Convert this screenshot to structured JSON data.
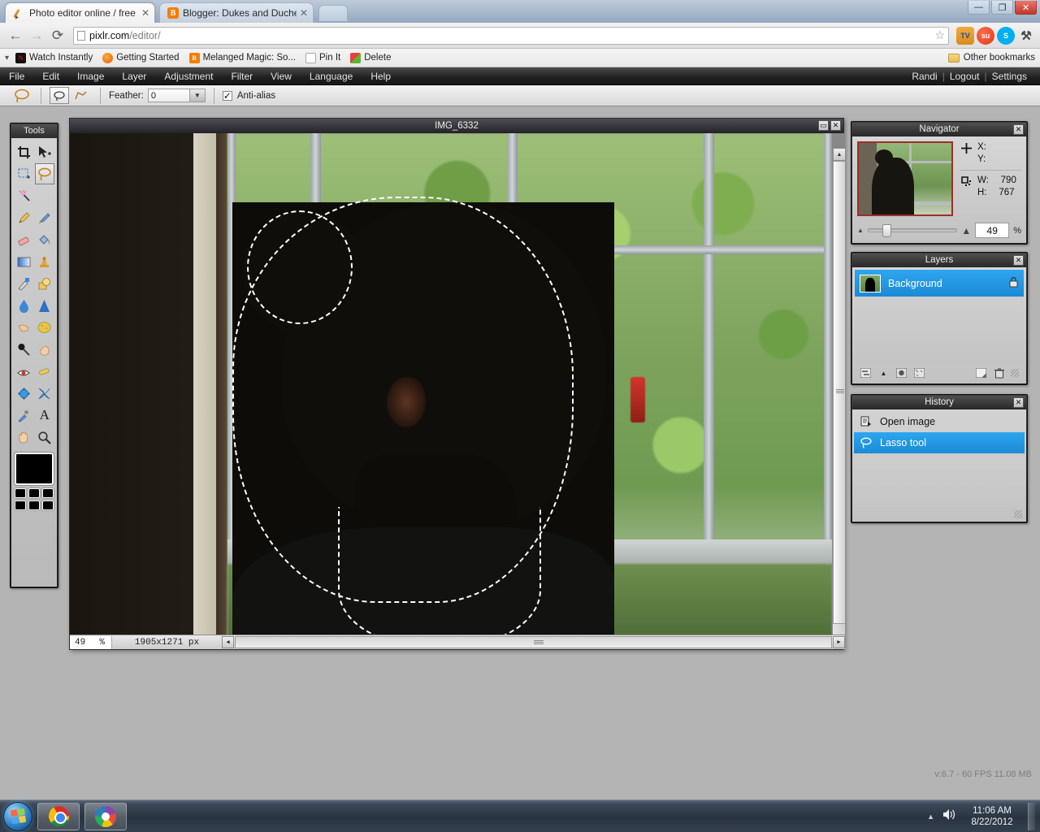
{
  "browser": {
    "tabs": [
      {
        "title": "Photo editor online / free i",
        "favicon": "pencil-icon",
        "active": true
      },
      {
        "title": "Blogger: Dukes and Duche",
        "favicon": "blogger-icon",
        "active": false
      }
    ],
    "new_tab_label": "",
    "window_buttons": {
      "minimize": "—",
      "maximize": "❐",
      "close": "✕"
    },
    "nav": {
      "back": "←",
      "forward": "→",
      "reload": "⟳"
    },
    "url": {
      "host": "pixlr.com",
      "path": "/editor/"
    },
    "star_icon": "☆",
    "extensions": [
      {
        "name": "tv-extension-icon",
        "label": "TV"
      },
      {
        "name": "stumbleupon-icon",
        "label": "su"
      },
      {
        "name": "skype-icon",
        "label": "S"
      },
      {
        "name": "wrench-menu-icon",
        "label": "⚒"
      }
    ],
    "bookmarks": [
      {
        "label": "Watch Instantly",
        "icon": "netflix-icon"
      },
      {
        "label": "Getting Started",
        "icon": "firefox-icon"
      },
      {
        "label": "Melanged Magic: So...",
        "icon": "blogger-icon"
      },
      {
        "label": "Pin It",
        "icon": "page-icon"
      },
      {
        "label": "Delete",
        "icon": "windows-icon"
      }
    ],
    "other_bookmarks": "Other bookmarks"
  },
  "pixlr": {
    "menus": [
      "File",
      "Edit",
      "Image",
      "Layer",
      "Adjustment",
      "Filter",
      "View",
      "Language",
      "Help"
    ],
    "account": {
      "user": "Randi",
      "logout": "Logout",
      "settings": "Settings",
      "separator": "|"
    },
    "options_bar": {
      "active_tool_icon": "lasso-icon",
      "mode_buttons": [
        {
          "name": "lasso-freehand-mode",
          "icon": "lasso-icon",
          "selected": true
        },
        {
          "name": "lasso-polygon-mode",
          "icon": "polygon-lasso-icon",
          "selected": false
        }
      ],
      "feather_label": "Feather:",
      "feather_value": "0",
      "antialias_label": "Anti-alias",
      "antialias_checked": true,
      "check_glyph": "✓",
      "dropdown_glyph": "▼"
    },
    "tools": {
      "title": "Tools",
      "items": [
        {
          "name": "crop-tool",
          "glyph": "⛶",
          "selected": false
        },
        {
          "name": "move-tool",
          "glyph": "➤",
          "selected": false
        },
        {
          "name": "marquee-select-tool",
          "glyph": "⬚",
          "selected": false
        },
        {
          "name": "lasso-tool",
          "glyph": "◯",
          "selected": true
        },
        {
          "name": "wand-select-tool",
          "glyph": "✦",
          "selected": false
        },
        {
          "name": "spacer-tool",
          "glyph": "",
          "selected": false
        },
        {
          "name": "pencil-tool",
          "glyph": "✎",
          "selected": false
        },
        {
          "name": "brush-tool",
          "glyph": "🖌",
          "selected": false
        },
        {
          "name": "eraser-tool",
          "glyph": "▰",
          "selected": false
        },
        {
          "name": "paint-bucket-tool",
          "glyph": "⛃",
          "selected": false
        },
        {
          "name": "gradient-tool",
          "glyph": "■",
          "selected": false
        },
        {
          "name": "clone-stamp-tool",
          "glyph": "♟",
          "selected": false
        },
        {
          "name": "replace-color-tool",
          "glyph": "✒",
          "selected": false
        },
        {
          "name": "drawing-shape-tool",
          "glyph": "▭",
          "selected": false
        },
        {
          "name": "blur-tool",
          "glyph": "💧",
          "selected": false
        },
        {
          "name": "sharpen-tool",
          "glyph": "▲",
          "selected": false
        },
        {
          "name": "smudge-tool",
          "glyph": "☛",
          "selected": false
        },
        {
          "name": "sponge-tool",
          "glyph": "⬤",
          "selected": false
        },
        {
          "name": "dodge-tool",
          "glyph": "🍥",
          "selected": false
        },
        {
          "name": "burn-tool",
          "glyph": "✋",
          "selected": false
        },
        {
          "name": "red-eye-tool",
          "glyph": "◉",
          "selected": false
        },
        {
          "name": "doodle-tool",
          "glyph": "▬",
          "selected": false
        },
        {
          "name": "bloat-tool",
          "glyph": "⬤",
          "selected": false
        },
        {
          "name": "pinch-tool",
          "glyph": "✧",
          "selected": false
        },
        {
          "name": "color-picker-tool",
          "glyph": "✐",
          "selected": false
        },
        {
          "name": "type-tool",
          "glyph": "A",
          "selected": false
        },
        {
          "name": "hand-tool",
          "glyph": "✋",
          "selected": false
        },
        {
          "name": "zoom-tool",
          "glyph": "🔍",
          "selected": false
        }
      ],
      "primary_color": "#000000",
      "palette_colors": [
        "#000000",
        "#000000",
        "#000000",
        "#000000",
        "#000000",
        "#000000"
      ]
    },
    "canvas_window": {
      "title": "IMG_6332",
      "maximize_glyph": "▭",
      "close_glyph": "✕",
      "status": {
        "zoom": "49",
        "percent": "%",
        "dimensions": "1905x1271 px"
      }
    },
    "navigator": {
      "title": "Navigator",
      "close_glyph": "✕",
      "crosshair_icon": "crosshair-icon",
      "selection_icon": "selection-bounds-icon",
      "x_label": "X:",
      "y_label": "Y:",
      "x_value": "",
      "y_value": "",
      "w_label": "W:",
      "h_label": "H:",
      "w_value": "790",
      "h_value": "767",
      "zoom_value": "49",
      "zoom_unit": "%"
    },
    "layers": {
      "title": "Layers",
      "close_glyph": "✕",
      "rows": [
        {
          "name": "Background",
          "selected": true,
          "locked": true,
          "lock_glyph": "🔒"
        }
      ],
      "toolbar_icons": [
        "layer-settings-icon",
        "layer-arrow-icon",
        "layer-mask-icon",
        "layer-style-icon",
        "new-layer-icon",
        "delete-layer-icon"
      ]
    },
    "history": {
      "title": "History",
      "close_glyph": "✕",
      "rows": [
        {
          "label": "Open image",
          "icon": "open-image-icon",
          "selected": false
        },
        {
          "label": "Lasso tool",
          "icon": "lasso-icon",
          "selected": true
        }
      ]
    },
    "version_info": "v:6.7 - 60 FPS 11.08 MB"
  },
  "taskbar": {
    "start_label": "Start",
    "items": [
      {
        "name": "taskbar-chrome",
        "label": "Google Chrome"
      },
      {
        "name": "taskbar-picasa",
        "label": "Picasa"
      }
    ],
    "tray": {
      "arrow": "▲",
      "volume": "🔊",
      "time": "11:06 AM",
      "date": "8/22/2012"
    }
  }
}
